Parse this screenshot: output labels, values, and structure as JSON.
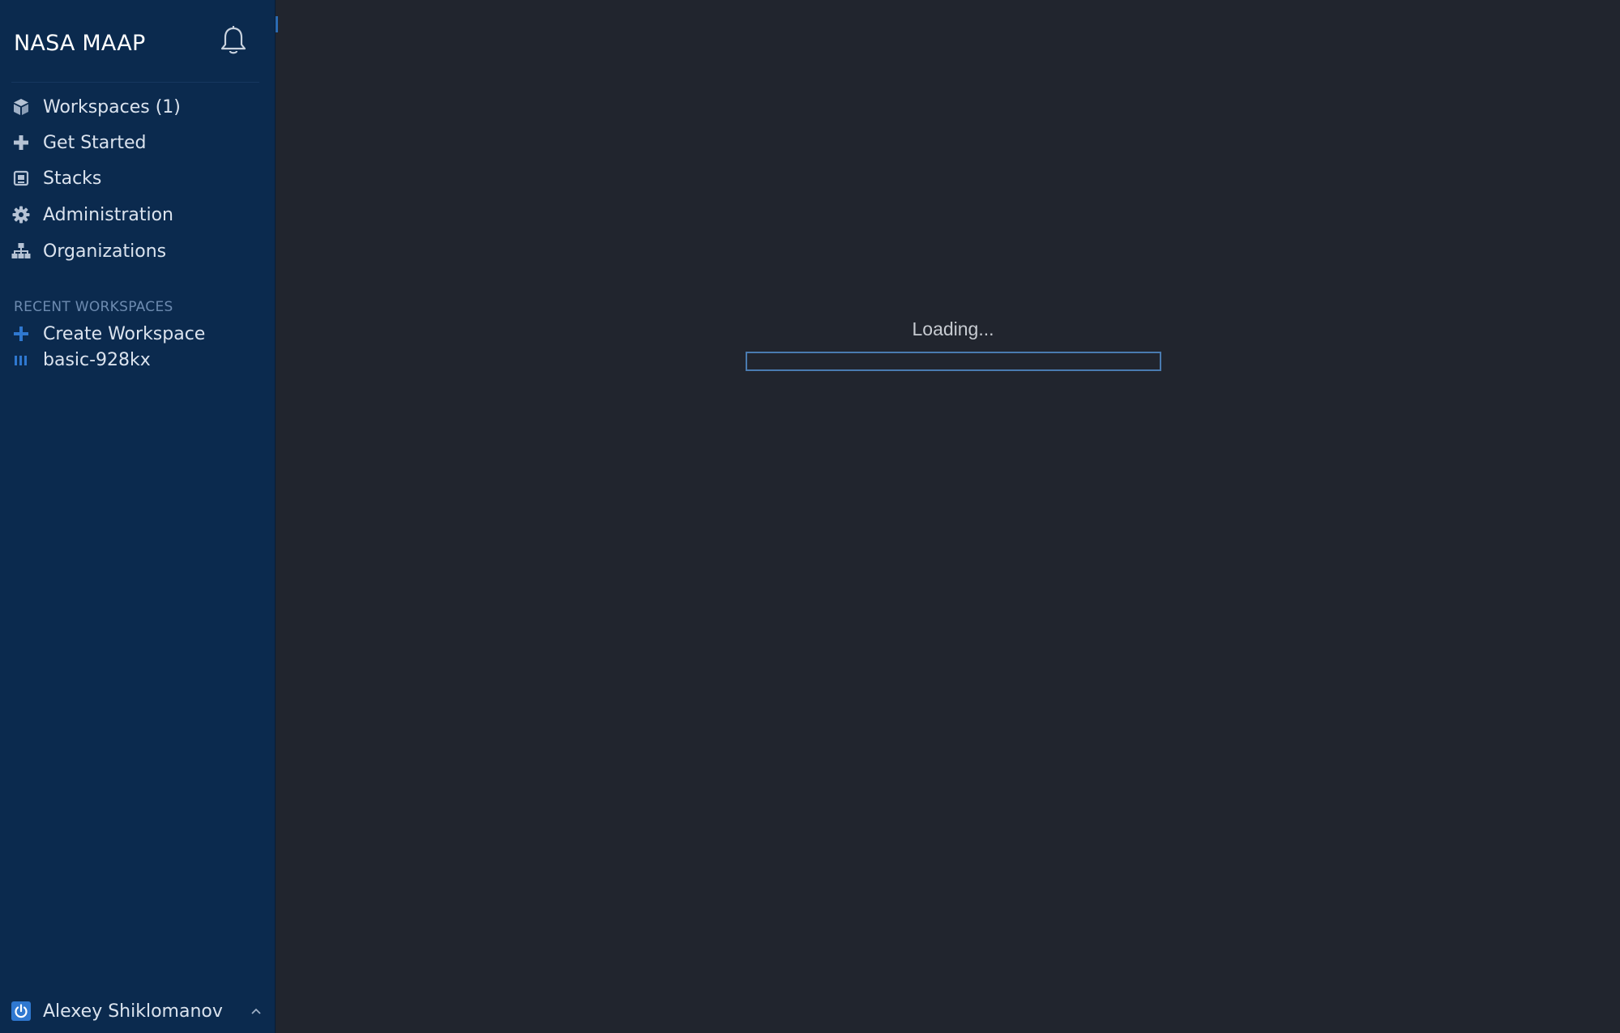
{
  "sidebar": {
    "brand": "NASA MAAP",
    "nav": [
      {
        "label": "Workspaces (1)",
        "icon": "cube-icon"
      },
      {
        "label": "Get Started",
        "icon": "plus-icon"
      },
      {
        "label": "Stacks",
        "icon": "stack-icon"
      },
      {
        "label": "Administration",
        "icon": "gear-icon"
      },
      {
        "label": "Organizations",
        "icon": "org-chart-icon"
      }
    ],
    "recent_title": "RECENT WORKSPACES",
    "recent": [
      {
        "label": "Create Workspace",
        "icon": "plus-icon"
      },
      {
        "label": "basic-928kx",
        "icon": "workspace-bars-icon"
      }
    ],
    "user": {
      "name": "Alexey Shiklomanov",
      "icon": "power-icon"
    }
  },
  "main": {
    "loading_text": "Loading...",
    "progress": 0
  },
  "colors": {
    "sidebar_bg": "#0b2a4e",
    "content_bg": "#21252e",
    "accent": "#2f6fb7"
  }
}
